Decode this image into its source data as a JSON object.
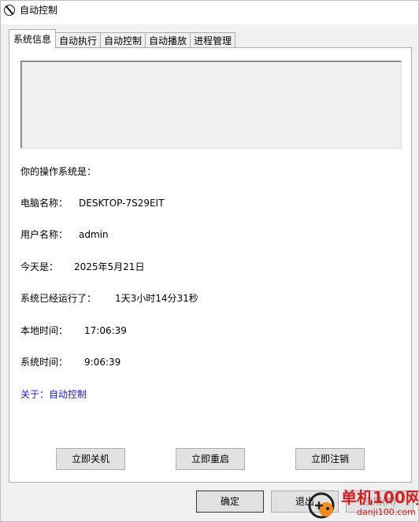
{
  "window": {
    "title": "自动控制"
  },
  "tabs": [
    {
      "label": "系统信息",
      "active": true
    },
    {
      "label": "自动执行",
      "active": false
    },
    {
      "label": "自动控制",
      "active": false
    },
    {
      "label": "自动播放",
      "active": false
    },
    {
      "label": "进程管理",
      "active": false
    }
  ],
  "system_info": {
    "os_label": "你的操作系统是：",
    "computer_name_label": "电脑名称：",
    "computer_name_value": "DESKTOP-7S29EIT",
    "user_name_label": "用户名称：",
    "user_name_value": "admin",
    "today_label": "今天是：",
    "today_value": "2025年5月21日",
    "uptime_label": "系统已经运行了：",
    "uptime_value": "1天3小时14分31秒",
    "local_time_label": "本地时间：",
    "local_time_value": "17:06:39",
    "system_time_label": "系统时间：",
    "system_time_value": "9:06:39",
    "about_text": "关于：自动控制"
  },
  "actions": {
    "shutdown_label": "立即关机",
    "restart_label": "立即重启",
    "logoff_label": "立即注销"
  },
  "footer": {
    "ok_label": "确定",
    "exit_label": "退出",
    "apply_label": "应用(A)"
  },
  "watermark": {
    "site_name": "单机100网",
    "url": "danji100.com"
  },
  "colors": {
    "about_link": "#1a1ad6",
    "watermark": "#d61f1f",
    "title_bar": "#ffffff",
    "window_bg": "#f0f0f0"
  }
}
